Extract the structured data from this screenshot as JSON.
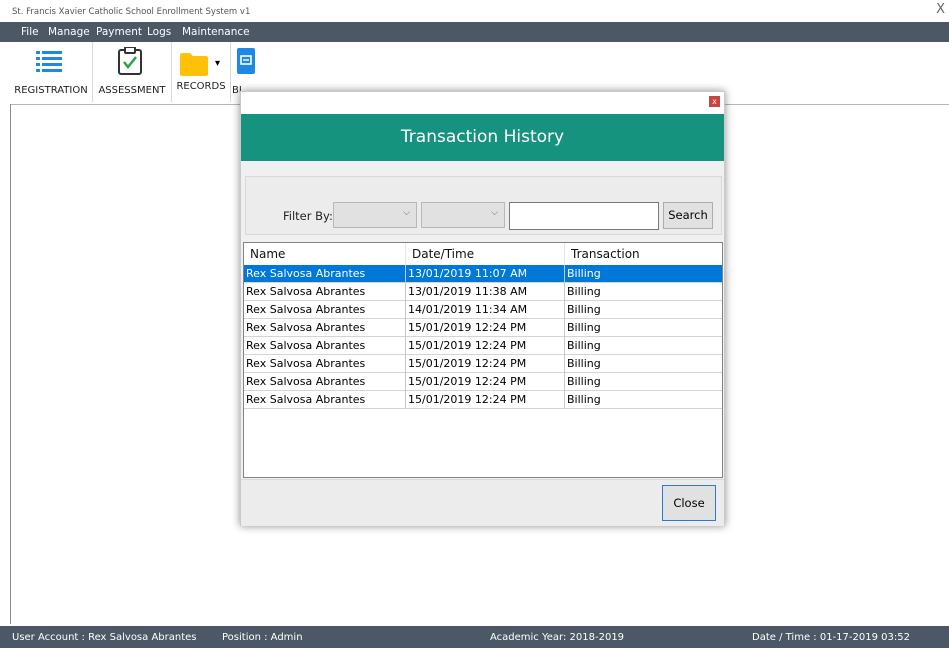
{
  "window": {
    "title": "St. Francis Xavier Catholic School Enrollment System v1",
    "close_glyph": "X"
  },
  "menu": [
    "File",
    "Manage",
    "Payment",
    "Logs",
    "Maintenance"
  ],
  "toolbar": {
    "registration": "REGISTRATION",
    "assessment": "ASSESSMENT",
    "records": "RECORDS",
    "billing_partial": "BI"
  },
  "dialog": {
    "close_glyph": "x",
    "title": "Transaction History",
    "filter_label": "Filter By:",
    "filter1_value": "",
    "filter2_value": "",
    "search_value": "",
    "search_button": "Search",
    "columns": [
      "Name",
      "Date/Time",
      "Transaction"
    ],
    "rows": [
      [
        "Rex Salvosa Abrantes",
        "13/01/2019 11:07 AM",
        "Billing"
      ],
      [
        "Rex Salvosa Abrantes",
        "13/01/2019 11:38 AM",
        "Billing"
      ],
      [
        "Rex Salvosa Abrantes",
        "14/01/2019 11:34 AM",
        "Billing"
      ],
      [
        "Rex Salvosa Abrantes",
        "15/01/2019 12:24 PM",
        "Billing"
      ],
      [
        "Rex Salvosa Abrantes",
        "15/01/2019 12:24 PM",
        "Billing"
      ],
      [
        "Rex Salvosa Abrantes",
        "15/01/2019 12:24 PM",
        "Billing"
      ],
      [
        "Rex Salvosa Abrantes",
        "15/01/2019 12:24 PM",
        "Billing"
      ],
      [
        "Rex Salvosa Abrantes",
        "15/01/2019 12:24 PM",
        "Billing"
      ]
    ],
    "selected_row": 0,
    "close_button": "Close"
  },
  "status": {
    "user": "User Account : Rex Salvosa Abrantes",
    "position": "Position : Admin",
    "academic_year": "Academic Year: 2018-2019",
    "datetime": "Date / Time : 01-17-2019 03:52"
  },
  "colors": {
    "header_teal": "#16937f",
    "bar_slate": "#4d5866",
    "selection": "#0078d7",
    "icon_blue": "#1e88e5",
    "folder_yellow": "#ffc107"
  }
}
